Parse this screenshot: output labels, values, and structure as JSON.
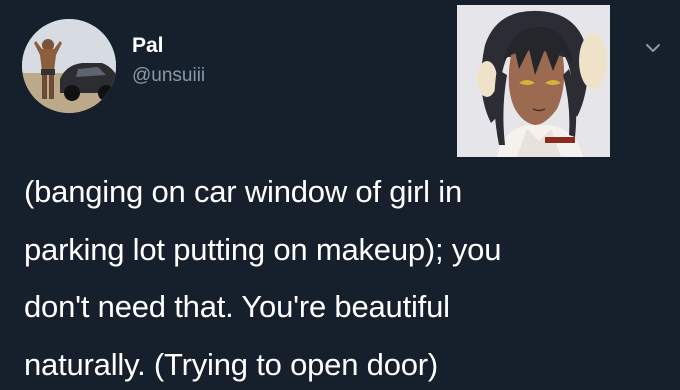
{
  "tweet": {
    "author": {
      "display_name": "Pal",
      "handle": "@unsuiii",
      "avatar_icon": "profile-photo-man-with-car"
    },
    "menu_icon": "chevron-down-icon",
    "attached_image_icon": "anime-character-portrait",
    "text_lines": [
      "(banging on car window of girl in",
      "parking lot putting on makeup); you",
      "don't need that. You're beautiful",
      "naturally. (Trying to open door)"
    ]
  },
  "colors": {
    "background": "#16202c",
    "text": "#ffffff",
    "secondary_text": "#8899a6"
  }
}
